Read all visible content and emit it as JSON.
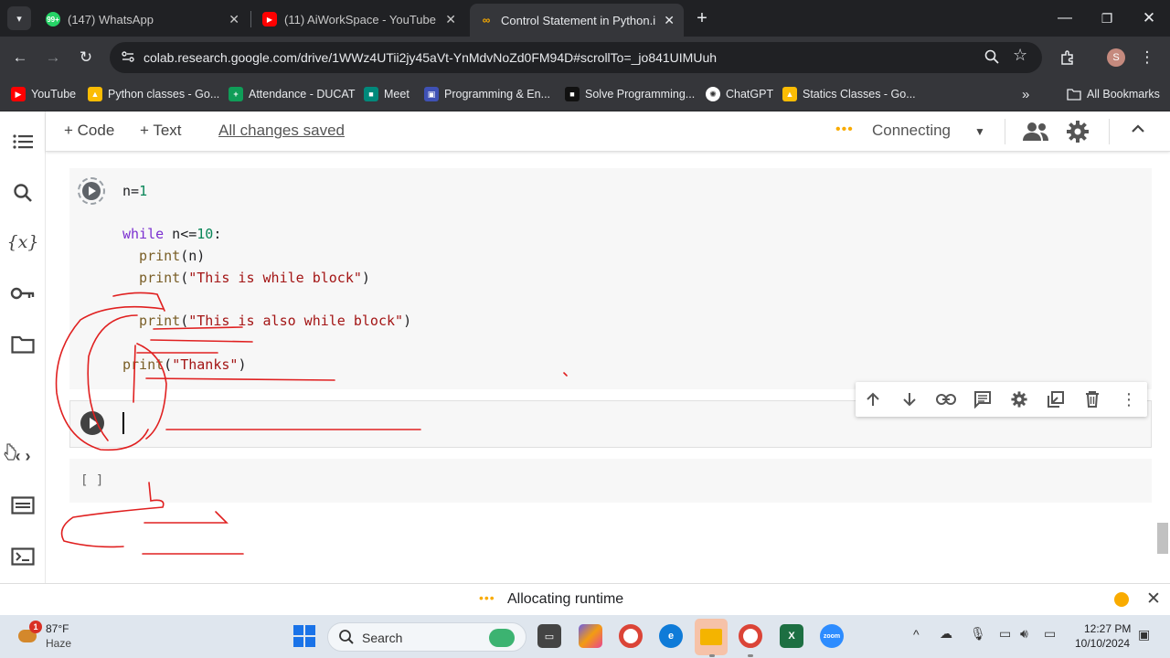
{
  "browser": {
    "tabs": [
      {
        "title": "(147) WhatsApp",
        "badge": "99+",
        "color": "#25d366",
        "active": false
      },
      {
        "title": "(11) AiWorkSpace - YouTube",
        "color": "#ff0000",
        "active": false
      },
      {
        "title": "Control Statement in Python.ipynb",
        "color": "#f9ab00",
        "active": true
      }
    ],
    "url": "colab.research.google.com/drive/1WWz4UTii2jy45aVt-YnMdvNoZd0FM94D#scrollTo=_jo841UIMUuh",
    "profile_initial": "S",
    "bookmarks": [
      {
        "label": "YouTube",
        "color": "#ff0000"
      },
      {
        "label": "Python classes - Go...",
        "color": "#fbbc04"
      },
      {
        "label": "Attendance - DUCAT",
        "color": "#0f9d58"
      },
      {
        "label": "Meet",
        "color": "#00897b"
      },
      {
        "label": "Programming & En...",
        "color": "#3f51b5"
      },
      {
        "label": "Solve Programming...",
        "color": "#111111"
      },
      {
        "label": "ChatGPT",
        "color": "#444444"
      },
      {
        "label": "Statics Classes - Go...",
        "color": "#fbbc04"
      }
    ],
    "all_bookmarks": "All Bookmarks"
  },
  "colab": {
    "add_code": "+ Code",
    "add_text": "+ Text",
    "save_status": "All changes saved",
    "connection": "Connecting",
    "cell1_code": {
      "l1a": "n=",
      "l1b": "1",
      "l2kw": "while",
      "l2a": " n<=",
      "l2n": "10",
      "l2b": ":",
      "l3fn": "  print",
      "l3a": "(n)",
      "l4fn": "  print",
      "l4a": "(",
      "l4s": "\"This is while block\"",
      "l4b": ")",
      "l5fn": "  print",
      "l5a": "(",
      "l5s": "\"This is also while block\"",
      "l5b": ")",
      "l6fn": "print",
      "l6a": "(",
      "l6s": "\"Thanks\"",
      "l6b": ")"
    },
    "empty_cell_marker": "[ ]",
    "status_text": "Allocating runtime"
  },
  "taskbar": {
    "weather_temp": "87°F",
    "weather_desc": "Haze",
    "weather_badge": "1",
    "search_placeholder": "Search",
    "time": "12:27 PM",
    "date": "10/10/2024"
  },
  "colors": {
    "annotation": "#e02020",
    "accent_orange": "#f9ab00"
  }
}
